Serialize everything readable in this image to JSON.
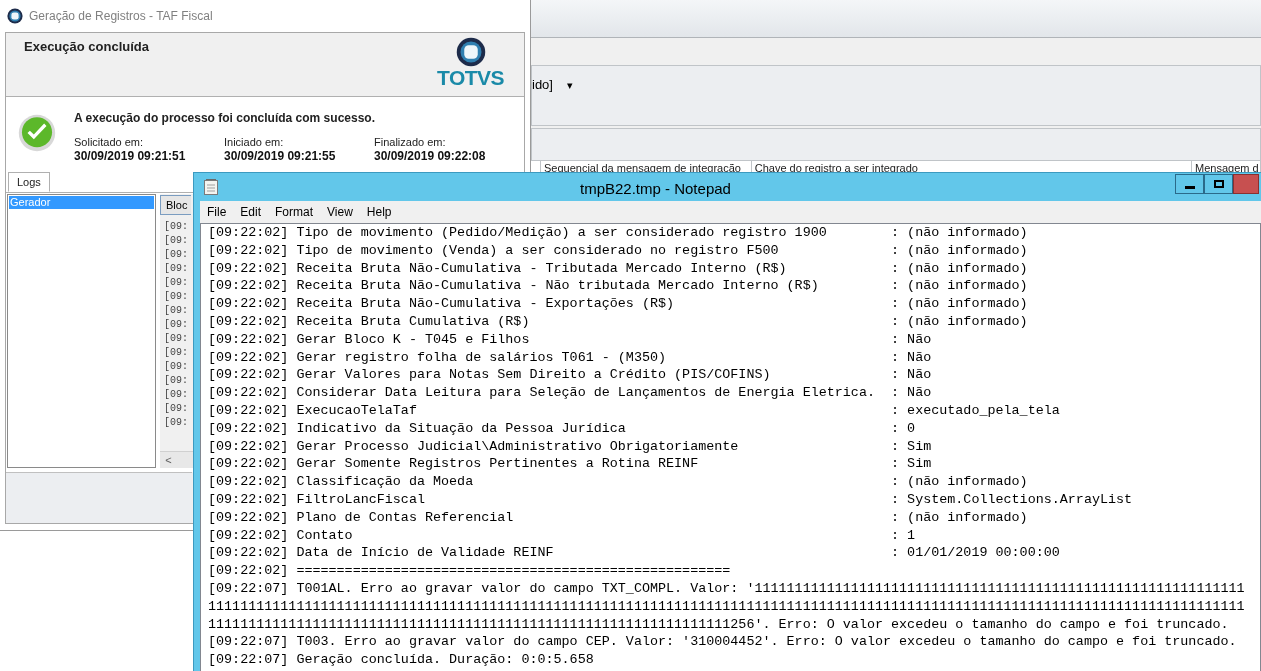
{
  "background_window": {
    "combo_text": "ido]",
    "combo_arrow": "▾",
    "columns": [
      "Sequencial da mensagem de integração",
      "Chave do registro a ser integrado",
      "Mensagem d"
    ]
  },
  "dialog": {
    "title": "Geração de Registros - TAF Fiscal",
    "header": "Execução concluída",
    "logo_text": "TOTVS",
    "message": "A execução do processo foi concluída com sucesso.",
    "times": [
      {
        "label": "Solicitado em:",
        "value": "30/09/2019 09:21:51"
      },
      {
        "label": "Iniciado em:",
        "value": "30/09/2019 09:21:55"
      },
      {
        "label": "Finalizado em:",
        "value": "30/09/2019 09:22:08"
      }
    ],
    "tabs": [
      {
        "label": "Logs",
        "selected": true
      }
    ],
    "log_sources": [
      {
        "label": "Gerador",
        "selected": true
      }
    ],
    "block_button": "Bloc",
    "log_lines": [
      "[09:",
      "[09:",
      "[09:",
      "[09:",
      "[09:",
      "[09:",
      "[09:",
      "[09:",
      "[09:",
      "[09:",
      "[09:",
      "[09:",
      "[09:",
      "[09:",
      "[09:"
    ],
    "scroll_left": "<"
  },
  "notepad": {
    "title": "tmpB22.tmp - Notepad",
    "menu": [
      "File",
      "Edit",
      "Format",
      "View",
      "Help"
    ],
    "lines": [
      {
        "time": "[09:22:02]",
        "label": "Tipo de movimento (Pedido/Medição) a ser considerado registro 1900",
        "value": ": (não informado)"
      },
      {
        "time": "[09:22:02]",
        "label": "Tipo de movimento (Venda) a ser considerado no registro F500",
        "value": ": (não informado)"
      },
      {
        "time": "[09:22:02]",
        "label": "Receita Bruta Não-Cumulativa - Tributada Mercado Interno (R$)",
        "value": ": (não informado)"
      },
      {
        "time": "[09:22:02]",
        "label": "Receita Bruta Não-Cumulativa - Não tributada Mercado Interno (R$)",
        "value": ": (não informado)"
      },
      {
        "time": "[09:22:02]",
        "label": "Receita Bruta Não-Cumulativa - Exportações (R$)",
        "value": ": (não informado)"
      },
      {
        "time": "[09:22:02]",
        "label": "Receita Bruta Cumulativa (R$)",
        "value": ": (não informado)"
      },
      {
        "time": "[09:22:02]",
        "label": "Gerar Bloco K - T045 e Filhos",
        "value": ": Não"
      },
      {
        "time": "[09:22:02]",
        "label": "Gerar registro folha de salários T061 - (M350)",
        "value": ": Não"
      },
      {
        "time": "[09:22:02]",
        "label": "Gerar Valores para Notas Sem Direito a Crédito (PIS/COFINS)",
        "value": ": Não"
      },
      {
        "time": "[09:22:02]",
        "label": "Considerar Data Leitura para Seleção de Lançamentos de Energia Eletrica.",
        "value": ": Não"
      },
      {
        "time": "[09:22:02]",
        "label": "ExecucaoTelaTaf",
        "value": ": executado_pela_tela"
      },
      {
        "time": "[09:22:02]",
        "label": "Indicativo da Situação da Pessoa Jurídica",
        "value": ": 0"
      },
      {
        "time": "[09:22:02]",
        "label": "Gerar Processo Judicial\\Administrativo Obrigatoriamente",
        "value": ": Sim"
      },
      {
        "time": "[09:22:02]",
        "label": "Gerar Somente Registros Pertinentes a Rotina REINF",
        "value": ": Sim"
      },
      {
        "time": "[09:22:02]",
        "label": "Classificação da Moeda",
        "value": ": (não informado)"
      },
      {
        "time": "[09:22:02]",
        "label": "FiltroLancFiscal",
        "value": ": System.Collections.ArrayList"
      },
      {
        "time": "[09:22:02]",
        "label": "Plano de Contas Referencial",
        "value": ": (não informado)"
      },
      {
        "time": "[09:22:02]",
        "label": "Contato",
        "value": ": 1"
      },
      {
        "time": "[09:22:02]",
        "label": "Data de Início de Validade REINF",
        "value": ": 01/01/2019 00:00:00"
      },
      {
        "time": "[09:22:02]",
        "label": "======================================================"
      },
      {
        "time": "[09:22:07]",
        "label": "T001AL. Erro ao gravar valor do campo TXT_COMPL. Valor: '111111111111111111111111111111111111111111111111111111111111111111111111111111111111111111111111111111111111111111111111111111111111111111111111111111111111111111111111111111111111111111111111111111111111111111111111111111111111111111111111111111111111111256'. Erro: O valor excedeu o tamanho do campo e foi truncado."
      },
      {
        "time": "[09:22:07]",
        "label": "T003. Erro ao gravar valor do campo CEP. Valor: '310004452'. Erro: O valor excedeu o tamanho do campo e foi truncado."
      },
      {
        "time": "[09:22:07]",
        "label": "Geração concluída. Duração: 0:0:5.658"
      }
    ]
  }
}
